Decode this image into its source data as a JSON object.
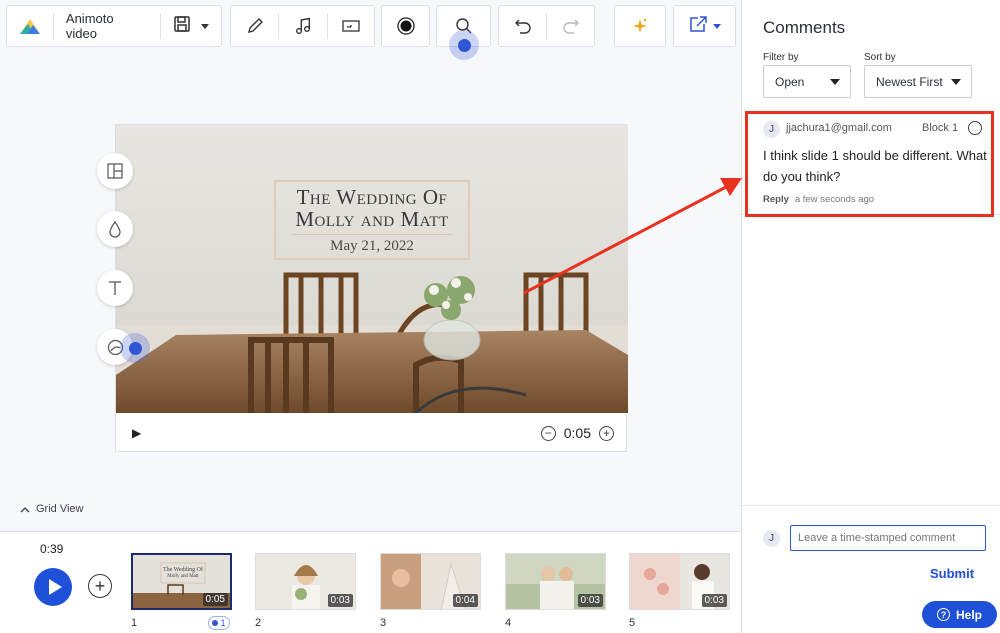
{
  "toolbar": {
    "app_name": "Animoto video",
    "icons": [
      "animoto-logo",
      "save-icon",
      "chevron-down-icon",
      "pen-icon",
      "music-icon",
      "aspect-ratio-icon",
      "record-icon",
      "search-icon",
      "undo-icon",
      "redo-icon",
      "sparkle-icon",
      "share-icon"
    ]
  },
  "side_tools": [
    "layout-icon",
    "color-drop-icon",
    "text-icon",
    "design-icon"
  ],
  "preview": {
    "title_line1": "The Wedding Of",
    "title_line2": "Molly and Matt",
    "date": "May 21, 2022",
    "duration": "0:05"
  },
  "grid_view_label": "Grid View",
  "timeline": {
    "total_time": "0:39",
    "blocks": [
      {
        "num": "1",
        "duration": "0:05",
        "selected": true,
        "comments": "1"
      },
      {
        "num": "2",
        "duration": "0:03"
      },
      {
        "num": "3",
        "duration": "0:04"
      },
      {
        "num": "4",
        "duration": "0:03"
      },
      {
        "num": "5",
        "duration": "0:03"
      }
    ]
  },
  "comments_panel": {
    "title": "Comments",
    "filter_label": "Filter by",
    "filter_value": "Open",
    "sort_label": "Sort by",
    "sort_value": "Newest First",
    "comment": {
      "avatar": "J",
      "email": "jjachura1@gmail.com",
      "block": "Block 1",
      "text": "I think slide 1 should be different. What do you think?",
      "reply_label": "Reply",
      "time": "a few seconds ago"
    },
    "input_avatar": "J",
    "input_placeholder": "Leave a time-stamped comment",
    "submit_label": "Submit",
    "help_label": "Help"
  },
  "colors": {
    "accent": "#1e50d8",
    "annotation": "#e8311e"
  }
}
